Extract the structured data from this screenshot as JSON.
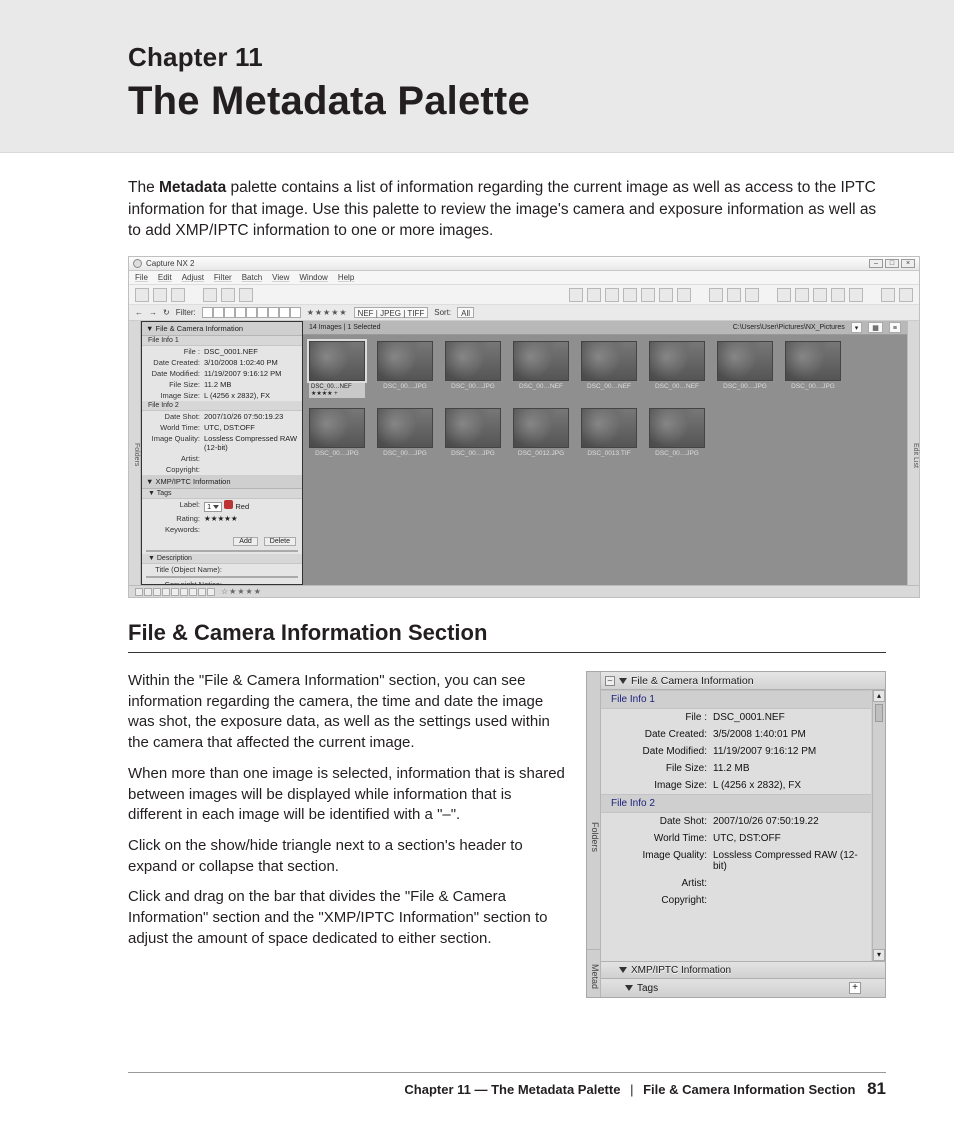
{
  "header": {
    "chapter_label": "Chapter 11",
    "chapter_title": "The Metadata Palette"
  },
  "intro": {
    "before_bold": "The ",
    "bold": "Metadata",
    "after_bold": " palette contains a list of information regarding the current image as well as access to the IPTC information for that image. Use this palette to review the image's camera and exposure information as well as to add XMP/IPTC information to one or more images."
  },
  "section_heading": "File & Camera Information Section",
  "paragraphs": [
    "Within the \"File & Camera Information\" section, you can see information regarding the camera, the time and date the image was shot, the exposure data, as well as the settings used within the camera that affected the current image.",
    "When more than one image is selected, information that is shared between images will be displayed while information that is different in each image will be identified with a \"–\".",
    "Click on the show/hide triangle next to a section's header to expand or collapse that section.",
    "Click and drag on the bar that divides the \"File & Camera Information\" section and the \"XMP/IPTC Information\" section to adjust the amount of space dedicated to either section."
  ],
  "footer": {
    "left": "Chapter 11 — The Metadata Palette",
    "right": "File & Camera Information Section",
    "page": "81"
  },
  "app": {
    "title": "Capture NX 2",
    "menus": [
      "File",
      "Edit",
      "Adjust",
      "Filter",
      "Batch",
      "View",
      "Window",
      "Help"
    ],
    "filter_label": "Filter:",
    "rating_stars": "★★★★★",
    "format_chips": "NEF | JPEG | TIFF",
    "sort_label": "Sort:",
    "sort_value": "All",
    "browser_header_left": "14 Images | 1 Selected",
    "browser_header_path": "C:\\Users\\User\\Pictures\\NX_Pictures",
    "side_left_label": "Folders",
    "side_right_label": "Edit List",
    "selected_thumb": {
      "name": "DSC_00…NEF",
      "meta": "★★★★ +"
    },
    "thumbs": [
      "DSC_00…JPG",
      "DSC_00…JPG",
      "DSC_00…NEF",
      "DSC_00…NEF",
      "DSC_00…NEF",
      "DSC_00…JPG",
      "DSC_00…JPG",
      "DSC_00…JPG",
      "DSC_00…JPG",
      "DSC_00…JPG",
      "DSC_0012.JPG",
      "DSC_0013.TIF",
      "DSC_00…JPG"
    ],
    "palette": {
      "header": "▼ File & Camera Information",
      "fileinfo1_hdr": "File Info 1",
      "fileinfo1": [
        {
          "k": "File :",
          "v": "DSC_0001.NEF"
        },
        {
          "k": "Date Created:",
          "v": "3/10/2008 1:02:40 PM"
        },
        {
          "k": "Date Modified:",
          "v": "11/19/2007 9:16:12 PM"
        },
        {
          "k": "File Size:",
          "v": "11.2 MB"
        },
        {
          "k": "Image Size:",
          "v": "L (4256 x 2832), FX"
        }
      ],
      "fileinfo2_hdr": "File Info 2",
      "fileinfo2": [
        {
          "k": "Date Shot:",
          "v": "2007/10/26 07:50:19.23"
        },
        {
          "k": "World Time:",
          "v": "UTC, DST:OFF"
        },
        {
          "k": "Image Quality:",
          "v": "Lossless Compressed RAW (12-bit)"
        },
        {
          "k": "Artist:",
          "v": ""
        },
        {
          "k": "Copyright:",
          "v": ""
        }
      ],
      "xmp_hdr": "▼ XMP/IPTC Information",
      "tags_hdr": "▼ Tags",
      "label_key": "Label:",
      "label_value": "1",
      "label_text": "Red",
      "rating_key": "Rating:",
      "rating_stars": "★★★★★",
      "keywords_key": "Keywords:",
      "add_btn": "Add",
      "delete_btn": "Delete",
      "desc_hdr": "▼ Description",
      "title_key": "Title (Object Name):",
      "copyright_key": "Copyright Notice:",
      "footer_stars": "☆★★★★"
    }
  },
  "mini": {
    "vtab_top": "Folders",
    "vtab_bottom": "Metad",
    "section_header": "File & Camera Information",
    "fileinfo1_hdr": "File Info 1",
    "fileinfo1": [
      {
        "k": "File :",
        "v": "DSC_0001.NEF"
      },
      {
        "k": "Date Created:",
        "v": "3/5/2008 1:40:01 PM"
      },
      {
        "k": "Date Modified:",
        "v": "11/19/2007 9:16:12 PM"
      },
      {
        "k": "File Size:",
        "v": "11.2 MB"
      },
      {
        "k": "Image Size:",
        "v": "L (4256 x 2832), FX"
      }
    ],
    "fileinfo2_hdr": "File Info 2",
    "fileinfo2": [
      {
        "k": "Date Shot:",
        "v": "2007/10/26 07:50:19.22"
      },
      {
        "k": "World Time:",
        "v": "UTC, DST:OFF"
      },
      {
        "k": "Image Quality:",
        "v": "Lossless Compressed RAW (12-bit)"
      },
      {
        "k": "Artist:",
        "v": ""
      },
      {
        "k": "Copyright:",
        "v": ""
      }
    ],
    "xmp_hdr": "XMP/IPTC Information",
    "tags_hdr": "Tags"
  }
}
